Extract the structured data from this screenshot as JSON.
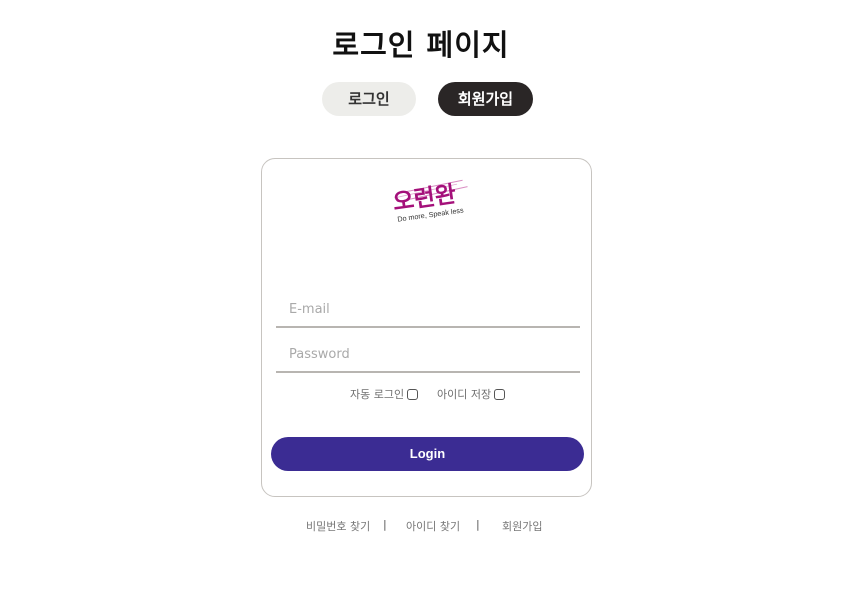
{
  "page": {
    "title": "로그인 페이지"
  },
  "tabs": [
    {
      "label": "로그인",
      "active": false
    },
    {
      "label": "회원가입",
      "active": true
    }
  ],
  "logo": {
    "text": "오런완",
    "tagline": "Do more, Speak less",
    "color": "#a4107a"
  },
  "form": {
    "email_placeholder": "E-mail",
    "email_value": "",
    "password_placeholder": "Password",
    "password_value": "",
    "auto_login_label": "자동 로그인",
    "auto_login_checked": false,
    "save_id_label": "아이디 저장",
    "save_id_checked": false,
    "login_button": "Login"
  },
  "footer_links": {
    "find_password": "비밀번호 찾기",
    "find_id": "아이디 찾기",
    "signup": "회원가입",
    "separator": "|"
  },
  "colors": {
    "login_button": "#3b2c93",
    "active_tab": "#2a2626",
    "inactive_tab": "#ededea",
    "logo": "#a4107a"
  }
}
